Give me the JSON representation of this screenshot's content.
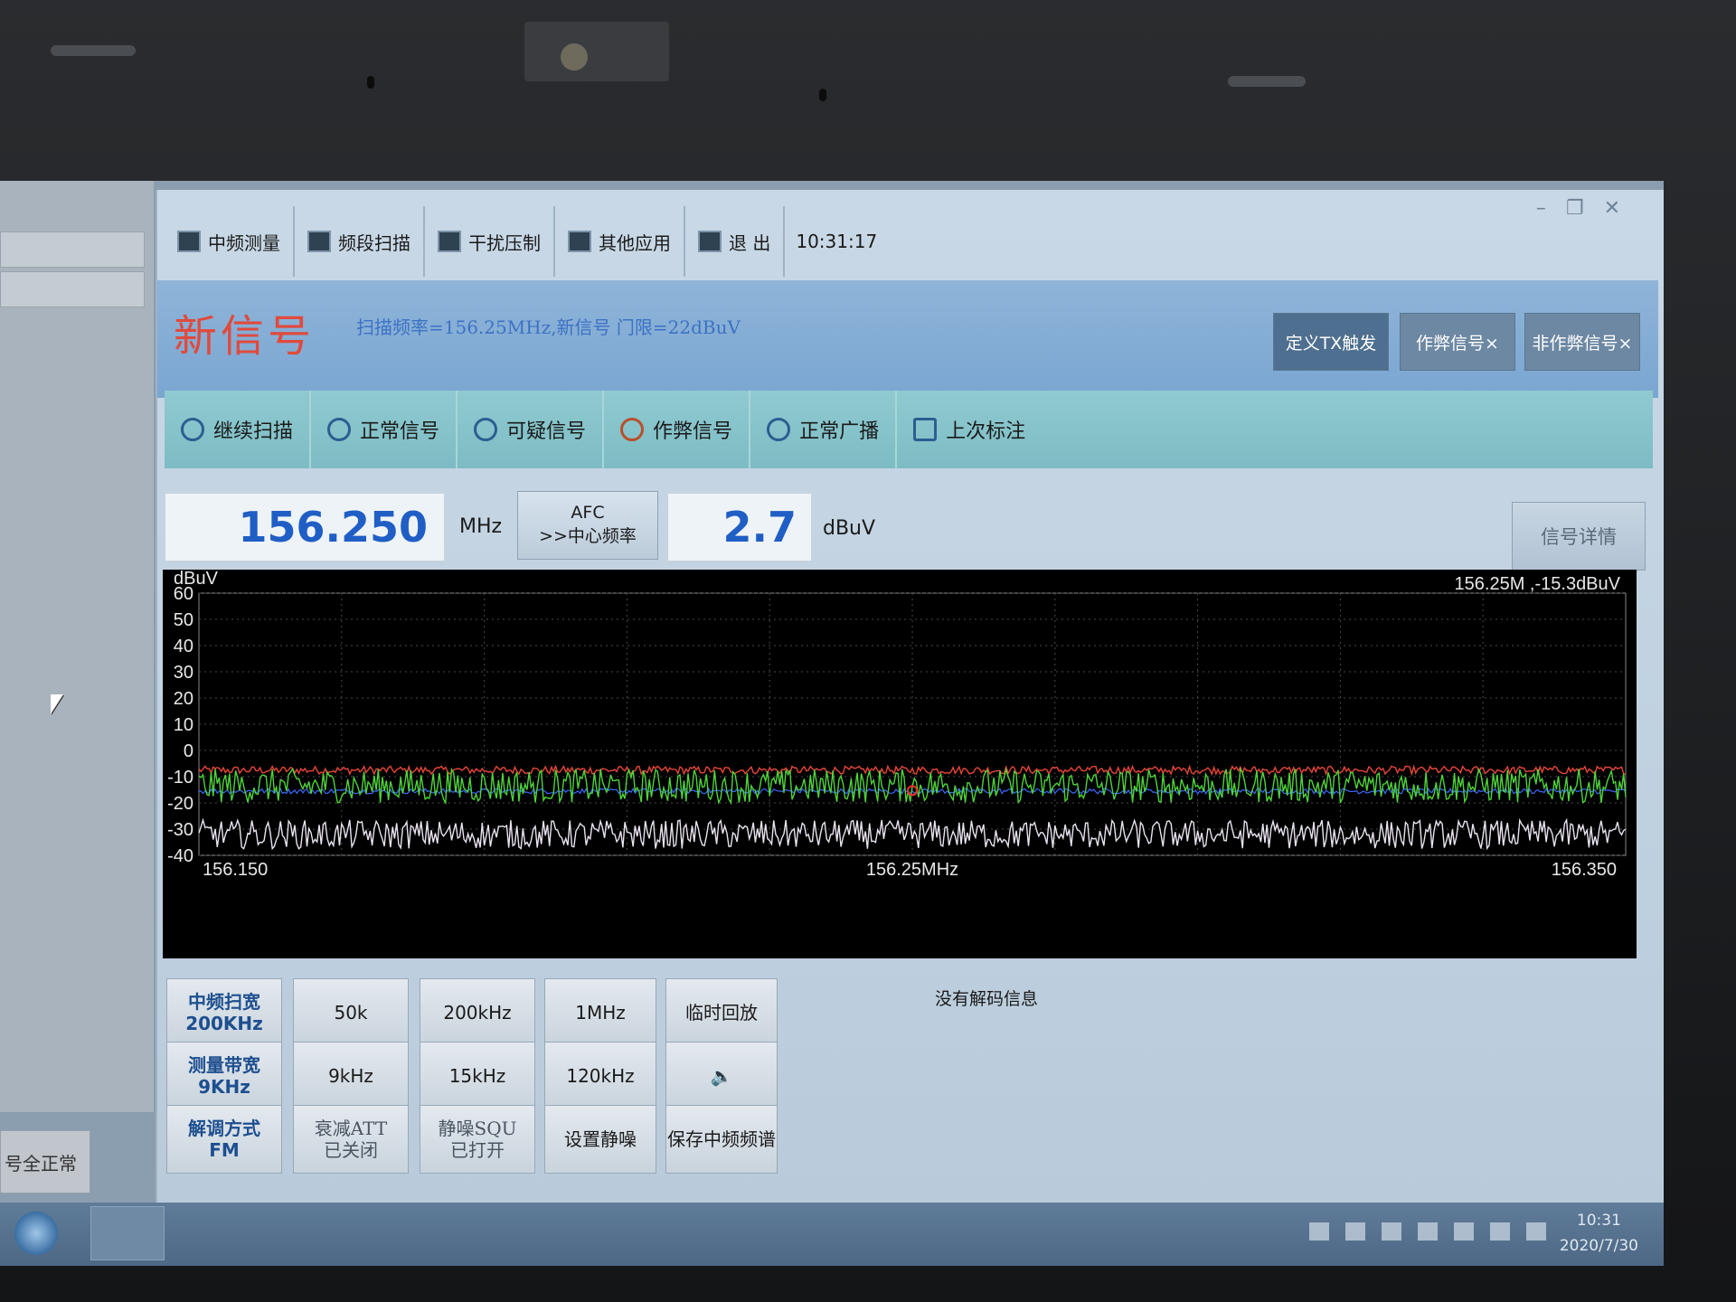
{
  "window": {
    "controls": [
      "–",
      "❐",
      "✕"
    ]
  },
  "menubar": {
    "items": [
      {
        "label": "中频测量",
        "icon": "meter-icon"
      },
      {
        "label": "频段扫描",
        "icon": "scan-icon"
      },
      {
        "label": "干扰压制",
        "icon": "jam-icon"
      },
      {
        "label": "其他应用",
        "icon": "apps-icon"
      },
      {
        "label": "退 出",
        "icon": "exit-icon"
      }
    ],
    "clock": "10:31:17"
  },
  "banner": {
    "title": "新信号",
    "info": "扫描频率=156.25MHz,新信号 门限=22dBuV",
    "buttons": [
      "定义TX触发",
      "作弊信号×",
      "非作弊信号×"
    ]
  },
  "toolbar2": {
    "items": [
      {
        "label": "继续扫描",
        "icon": "search-icon"
      },
      {
        "label": "正常信号",
        "icon": "antenna-icon"
      },
      {
        "label": "可疑信号",
        "icon": "antenna-icon"
      },
      {
        "label": "作弊信号",
        "icon": "warning-antenna-icon"
      },
      {
        "label": "正常广播",
        "icon": "speaker-icon"
      },
      {
        "label": "上次标注",
        "icon": "tag-icon"
      }
    ]
  },
  "readout": {
    "frequency": "156.250",
    "frequency_unit": "MHz",
    "afc_label_1": "AFC",
    "afc_label_2": ">>中心频率",
    "level": "2.7",
    "level_unit": "dBuV",
    "detail_button": "信号详情"
  },
  "side": {
    "status": "号全正常"
  },
  "chart_data": {
    "type": "line",
    "ylabel": "dBuV",
    "ylim": [
      -40,
      60
    ],
    "yticks": [
      60,
      50,
      40,
      30,
      20,
      10,
      0,
      -10,
      -20,
      -30,
      -40
    ],
    "x_ticks": [
      "156.150",
      "156.25MHz",
      "156.350"
    ],
    "xlim": [
      156.15,
      156.35
    ],
    "marker_readout": "156.25M ,-15.3dBuV",
    "grid": true,
    "series": [
      {
        "color": "#e8463a",
        "level": -7.5,
        "jitter": 1.5
      },
      {
        "color": "#3f68ff",
        "level": -15.5,
        "jitter": 1.0
      },
      {
        "color": "#4fd43a",
        "level": -13.5,
        "jitter": 6.5
      },
      {
        "color": "#e9e4f0",
        "level": -32,
        "jitter": 5.5
      }
    ],
    "marker": {
      "x": 156.25,
      "y": -15.3,
      "color": "#ff2a2a"
    }
  },
  "controls": {
    "rows": [
      [
        "中频扫宽\n200KHz",
        "50k",
        "200kHz",
        "1MHz",
        "临时回放"
      ],
      [
        "测量带宽\n9KHz",
        "9kHz",
        "15kHz",
        "120kHz",
        "🔈"
      ],
      [
        "解调方式\nFM",
        "衰减ATT\n已关闭",
        "静噪SQU\n已打开",
        "设置静噪",
        "保存中频频谱"
      ]
    ],
    "decode_info": "没有解码信息"
  },
  "taskbar": {
    "time": "10:31",
    "date": "2020/7/30"
  }
}
